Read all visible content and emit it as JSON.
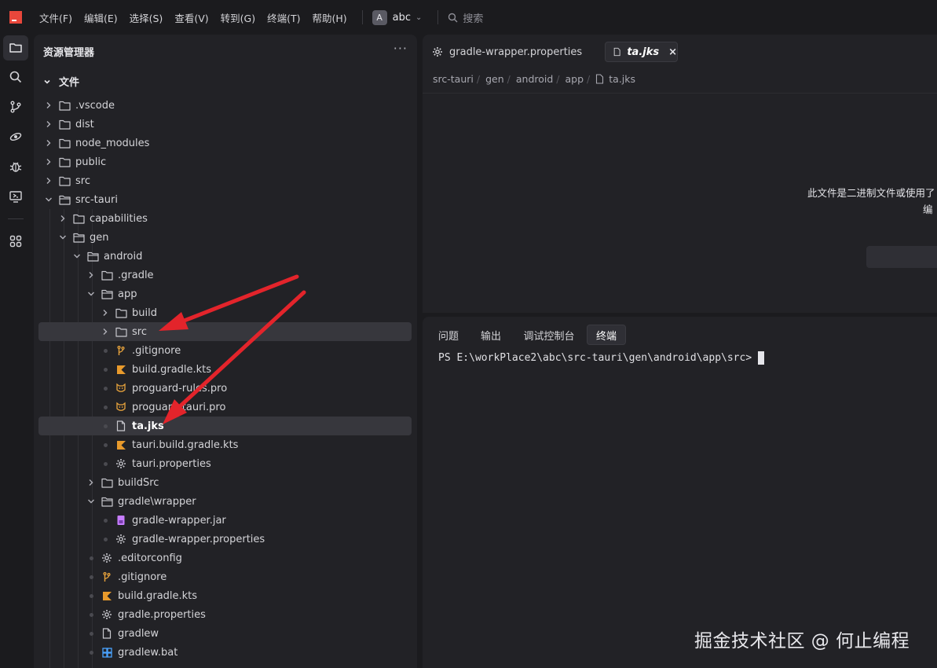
{
  "menubar": {
    "items": [
      "文件(F)",
      "编辑(E)",
      "选择(S)",
      "查看(V)",
      "转到(G)",
      "终端(T)",
      "帮助(H)"
    ],
    "project_initial": "A",
    "project_name": "abc",
    "search_placeholder": "搜索"
  },
  "activity_bar": {
    "icons": [
      "explorer-icon",
      "search-icon",
      "source-control-icon",
      "remote-explorer-icon",
      "debug-icon",
      "preview-icon",
      "extensions-icon"
    ]
  },
  "sidebar": {
    "title": "资源管理器",
    "root_label": "文件",
    "tree": [
      {
        "label": ".vscode",
        "kind": "folder",
        "depth": 0,
        "expanded": false
      },
      {
        "label": "dist",
        "kind": "folder",
        "depth": 0,
        "expanded": false
      },
      {
        "label": "node_modules",
        "kind": "folder",
        "depth": 0,
        "expanded": false
      },
      {
        "label": "public",
        "kind": "folder",
        "depth": 0,
        "expanded": false
      },
      {
        "label": "src",
        "kind": "folder",
        "depth": 0,
        "expanded": false
      },
      {
        "label": "src-tauri",
        "kind": "folder",
        "depth": 0,
        "expanded": true
      },
      {
        "label": "capabilities",
        "kind": "folder",
        "depth": 1,
        "expanded": false
      },
      {
        "label": "gen",
        "kind": "folder",
        "depth": 1,
        "expanded": true
      },
      {
        "label": "android",
        "kind": "folder",
        "depth": 2,
        "expanded": true
      },
      {
        "label": ".gradle",
        "kind": "folder",
        "depth": 3,
        "expanded": false
      },
      {
        "label": "app",
        "kind": "folder",
        "depth": 3,
        "expanded": true
      },
      {
        "label": "build",
        "kind": "folder",
        "depth": 4,
        "expanded": false
      },
      {
        "label": "src",
        "kind": "folder",
        "depth": 4,
        "expanded": false,
        "selected": true
      },
      {
        "label": ".gitignore",
        "kind": "git",
        "depth": 4
      },
      {
        "label": "build.gradle.kts",
        "kind": "kotlin",
        "depth": 4
      },
      {
        "label": "proguard-rules.pro",
        "kind": "pro",
        "depth": 4
      },
      {
        "label": "proguard-tauri.pro",
        "kind": "pro",
        "depth": 4
      },
      {
        "label": "ta.jks",
        "kind": "file",
        "depth": 4,
        "selected": true,
        "current": true
      },
      {
        "label": "tauri.build.gradle.kts",
        "kind": "kotlin",
        "depth": 4
      },
      {
        "label": "tauri.properties",
        "kind": "gear",
        "depth": 4
      },
      {
        "label": "buildSrc",
        "kind": "folder",
        "depth": 3,
        "expanded": false
      },
      {
        "label": "gradle\\wrapper",
        "kind": "folder",
        "depth": 3,
        "expanded": true
      },
      {
        "label": "gradle-wrapper.jar",
        "kind": "jar",
        "depth": 4
      },
      {
        "label": "gradle-wrapper.properties",
        "kind": "gear",
        "depth": 4
      },
      {
        "label": ".editorconfig",
        "kind": "gear",
        "depth": 3
      },
      {
        "label": ".gitignore",
        "kind": "git",
        "depth": 3
      },
      {
        "label": "build.gradle.kts",
        "kind": "kotlin",
        "depth": 3
      },
      {
        "label": "gradle.properties",
        "kind": "gear",
        "depth": 3
      },
      {
        "label": "gradlew",
        "kind": "file",
        "depth": 3
      },
      {
        "label": "gradlew.bat",
        "kind": "windows",
        "depth": 3
      }
    ]
  },
  "editor": {
    "tabs": [
      {
        "label": "gradle-wrapper.properties",
        "icon": "gear-icon",
        "active": false
      },
      {
        "label": "ta.jks",
        "icon": "file-icon",
        "active": true,
        "close": "×"
      }
    ],
    "breadcrumb": [
      "src-tauri",
      "gen",
      "android",
      "app",
      "ta.jks"
    ],
    "message_line1": "此文件是二进制文件或使用了",
    "message_line2": "编"
  },
  "panel": {
    "tabs": [
      "问题",
      "输出",
      "调试控制台",
      "终端"
    ],
    "active_tab": "终端",
    "terminal_line": "PS E:\\workPlace2\\abc\\src-tauri\\gen\\android\\app\\src>"
  },
  "watermark": "掘金技术社区 @ 何止编程",
  "colors": {
    "accent_red": "#e8473b",
    "folder": "#c8c8ce",
    "git_orange": "#e8a33c",
    "kotlin_orange": "#e89a2c",
    "jar_purple": "#c77dff",
    "windows_blue": "#4aa3ff",
    "annotation_arrow": "#e3242b"
  }
}
